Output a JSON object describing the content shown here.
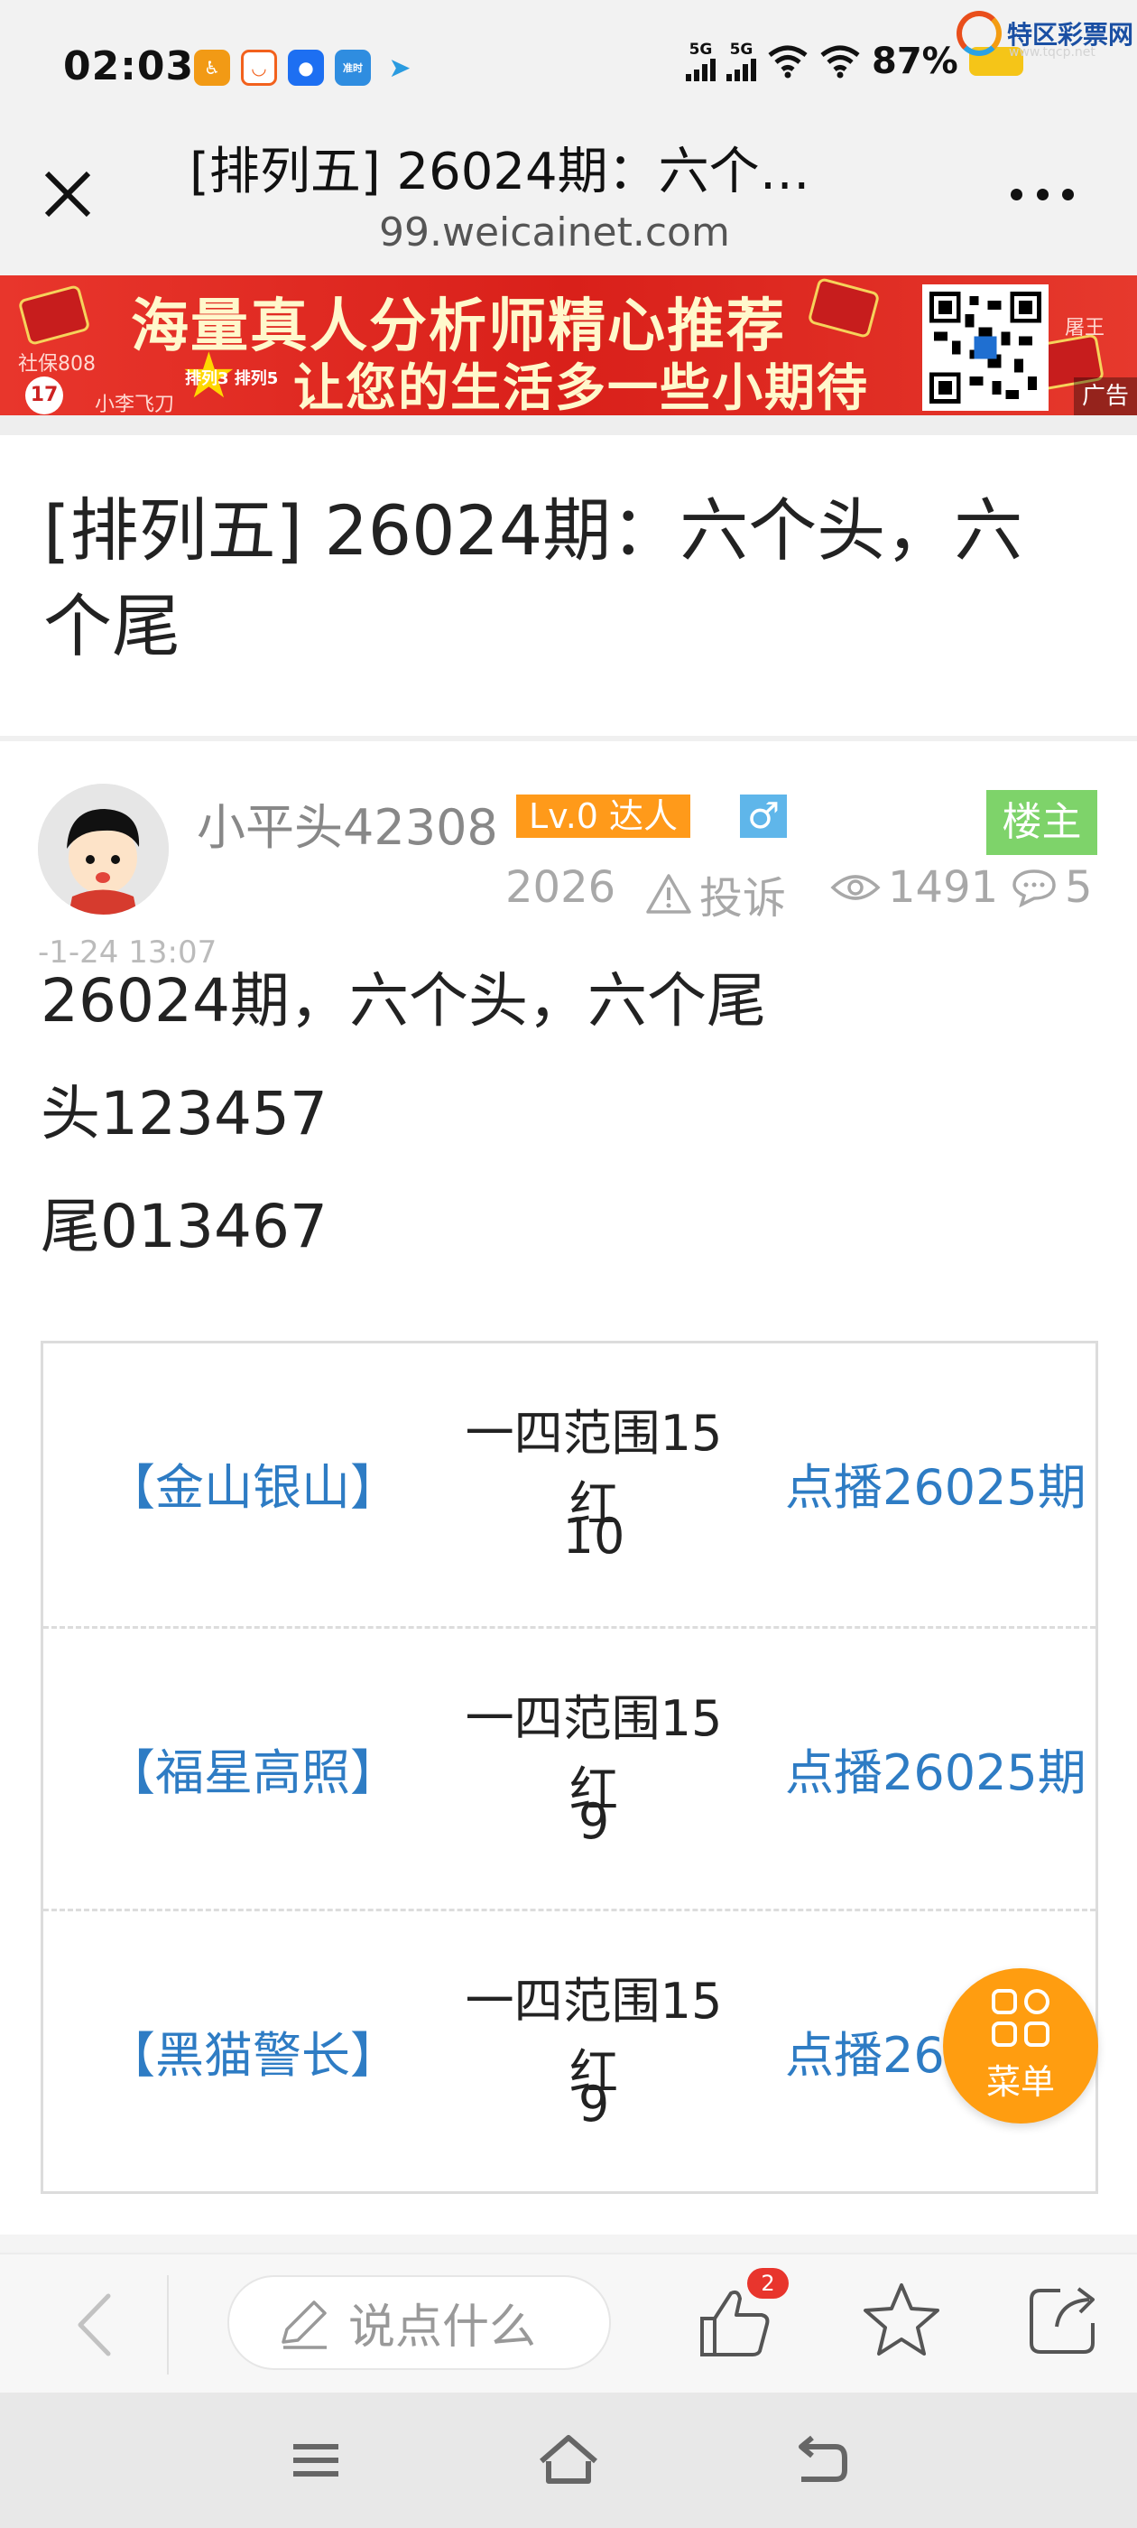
{
  "status_bar": {
    "time": "02:03",
    "network_1": "5G",
    "network_2": "5G",
    "battery": "87%",
    "app_icon_label": "准时"
  },
  "watermark": {
    "brand": "特区彩票网",
    "site": "www.tqcp.net"
  },
  "nav": {
    "title": "[排列五] 26024期：六个…",
    "url": "99.weicainet.com"
  },
  "ad": {
    "line1": "海量真人分析师精心推荐",
    "line2": "让您的生活多一些小期待",
    "tag": "广告",
    "small_left_1": "社保808",
    "small_left_2": "小李飞刀",
    "small_badge": "排列3 排列5",
    "small_right": "屠王",
    "number_ball": "17"
  },
  "post": {
    "title": "[排列五] 26024期：六个头，六个尾",
    "author": "小平头42308",
    "level": "Lv.0 达人",
    "gender_icon": "♂",
    "owner_label": "楼主",
    "year": "2026",
    "report_label": "投诉",
    "views": "1491",
    "comments": "5",
    "date_rest": "-1-24 13:07",
    "lines": [
      "26024期，六个头，六个尾",
      "头123457",
      "尾013467"
    ]
  },
  "table": {
    "rows": [
      {
        "name": "【金山银山】",
        "desc": "一四范围15红",
        "value": "10",
        "link": "点播26025期"
      },
      {
        "name": "【福星高照】",
        "desc": "一四范围15红",
        "value": "9",
        "link": "点播26025期"
      },
      {
        "name": "【黑猫警长】",
        "desc": "一四范围15红",
        "value": "9",
        "link": "点播26"
      }
    ]
  },
  "fab": {
    "label": "菜单"
  },
  "toolbar": {
    "comment_placeholder": "说点什么",
    "like_count": "2"
  },
  "colors": {
    "accent_orange": "#ff9d10",
    "link_blue": "#2e7cc4",
    "owner_green": "#7ed36a",
    "ad_red": "#d9201a"
  }
}
